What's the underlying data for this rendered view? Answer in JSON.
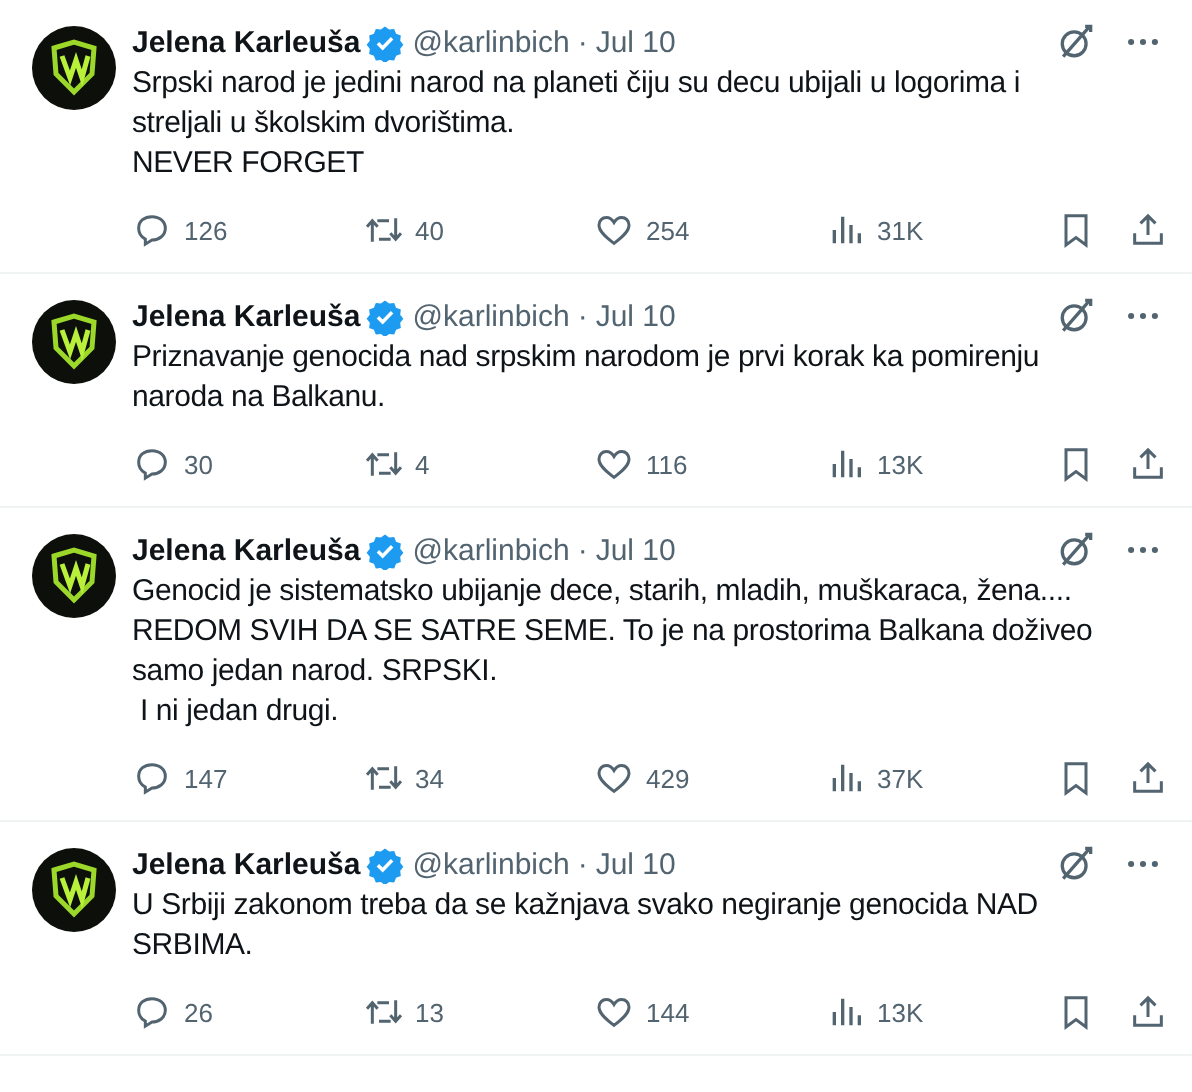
{
  "tweets": [
    {
      "name": "Jelena Karleuša",
      "verified": true,
      "handle": "@karlinbich",
      "dot": "·",
      "date": "Jul 10",
      "text": "Srpski narod je jedini narod na planeti čiju su decu ubijali u logorima i\nstreljali u školskim dvorištima.\nNEVER FORGET",
      "actions": [
        {
          "kind": "reply",
          "count": "126"
        },
        {
          "kind": "repost",
          "count": "40"
        },
        {
          "kind": "like",
          "count": "254"
        },
        {
          "kind": "views",
          "count": "31K"
        }
      ]
    },
    {
      "name": "Jelena Karleuša",
      "verified": true,
      "handle": "@karlinbich",
      "dot": "·",
      "date": "Jul 10",
      "text": "Priznavanje genocida nad srpskim narodom je prvi korak ka pomirenju\nnaroda na Balkanu.",
      "actions": [
        {
          "kind": "reply",
          "count": "30"
        },
        {
          "kind": "repost",
          "count": "4"
        },
        {
          "kind": "like",
          "count": "116"
        },
        {
          "kind": "views",
          "count": "13K"
        }
      ]
    },
    {
      "name": "Jelena Karleuša",
      "verified": true,
      "handle": "@karlinbich",
      "dot": "·",
      "date": "Jul 10",
      "text": "Genocid je sistematsko ubijanje dece, starih, mladih, muškaraca, žena....\nREDOM SVIH DA SE SATRE SEME. To je na prostorima Balkana doživeo\nsamo jedan narod. SRPSKI.\n I ni jedan drugi.",
      "actions": [
        {
          "kind": "reply",
          "count": "147"
        },
        {
          "kind": "repost",
          "count": "34"
        },
        {
          "kind": "like",
          "count": "429"
        },
        {
          "kind": "views",
          "count": "37K"
        }
      ]
    },
    {
      "name": "Jelena Karleuša",
      "verified": true,
      "handle": "@karlinbich",
      "dot": "·",
      "date": "Jul 10",
      "text": "U Srbiji zakonom treba da se kažnjava svako negiranje genocida NAD\nSRBIMA.",
      "actions": [
        {
          "kind": "reply",
          "count": "26"
        },
        {
          "kind": "repost",
          "count": "13"
        },
        {
          "kind": "like",
          "count": "144"
        },
        {
          "kind": "views",
          "count": "13K"
        }
      ]
    }
  ]
}
